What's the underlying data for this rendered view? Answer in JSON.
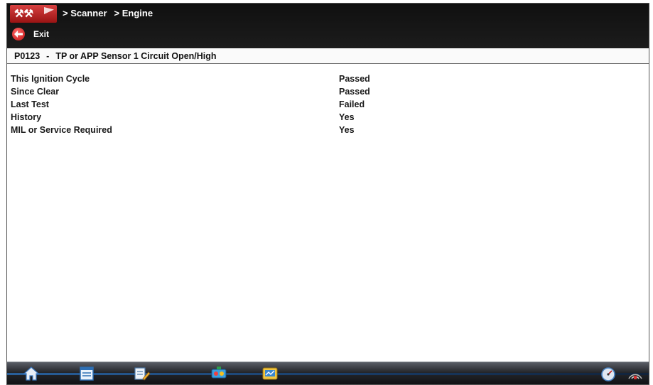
{
  "header": {
    "breadcrumb": [
      "> Scanner",
      "> Engine"
    ],
    "exit_label": "Exit"
  },
  "code": {
    "id": "P0123",
    "separator": "-",
    "description": "TP or APP Sensor 1 Circuit Open/High"
  },
  "status_rows": [
    {
      "label": "This Ignition Cycle",
      "value": "Passed"
    },
    {
      "label": "Since Clear",
      "value": "Passed"
    },
    {
      "label": "Last Test",
      "value": "Failed"
    },
    {
      "label": "History",
      "value": "Yes"
    },
    {
      "label": "MIL or Service Required",
      "value": "Yes"
    }
  ],
  "taskbar": {
    "icons": [
      "home-icon",
      "document-icon",
      "pencil-document-icon",
      "scanner-tool-icon",
      "data-viewer-icon",
      "gauge-icon",
      "signal-icon"
    ]
  },
  "colors": {
    "header_bg": "#111111",
    "logo_red": "#c62020",
    "exit_red": "#d01818",
    "taskbar_dark": "#1b1c20",
    "taskbar_accent": "#2a6fb8"
  }
}
